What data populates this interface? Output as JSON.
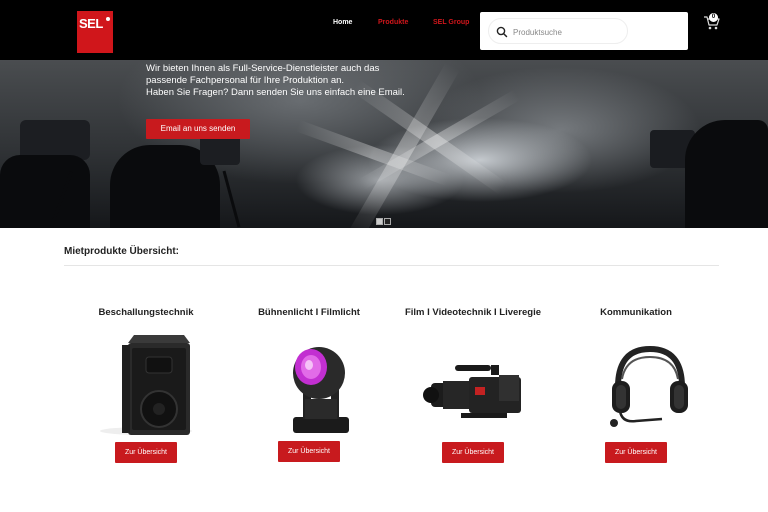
{
  "header": {
    "logo_text": "SEL",
    "nav": [
      {
        "label": "Home",
        "color": "#ffffff"
      },
      {
        "label": "Produkte",
        "color": "#d0161b"
      },
      {
        "label": "SEL Group",
        "color": "#d0161b"
      }
    ],
    "search": {
      "placeholder": "Produktsuche",
      "value": "",
      "icon": "search-icon"
    },
    "cart": {
      "icon": "cart-icon",
      "count": "0"
    }
  },
  "hero": {
    "lines": [
      "Wir bieten Ihnen als Full-Service-Dienstleister auch das",
      "passende Fachpersonal für Ihre Produktion an.",
      "Haben Sie Fragen? Dann senden Sie uns einfach eine Email."
    ],
    "button_label": "Email an uns senden",
    "slides": {
      "total": 2,
      "active": 1
    }
  },
  "main": {
    "section_title": "Mietprodukte Übersicht:",
    "products": [
      {
        "title": "Beschallungstechnik",
        "button_label": "Zur Übersicht",
        "image": "speaker-image"
      },
      {
        "title": "Bühnenlicht I Filmlicht",
        "button_label": "Zur Übersicht",
        "image": "moving-head-light-image"
      },
      {
        "title": "Film I Videotechnik I Liveregie",
        "button_label": "Zur Übersicht",
        "image": "video-camera-image"
      },
      {
        "title": "Kommunikation",
        "button_label": "Zur Übersicht",
        "image": "headset-image"
      }
    ]
  },
  "colors": {
    "accent": "#c81a1e",
    "header_bg": "#000000",
    "logo_red": "#d0161b"
  }
}
